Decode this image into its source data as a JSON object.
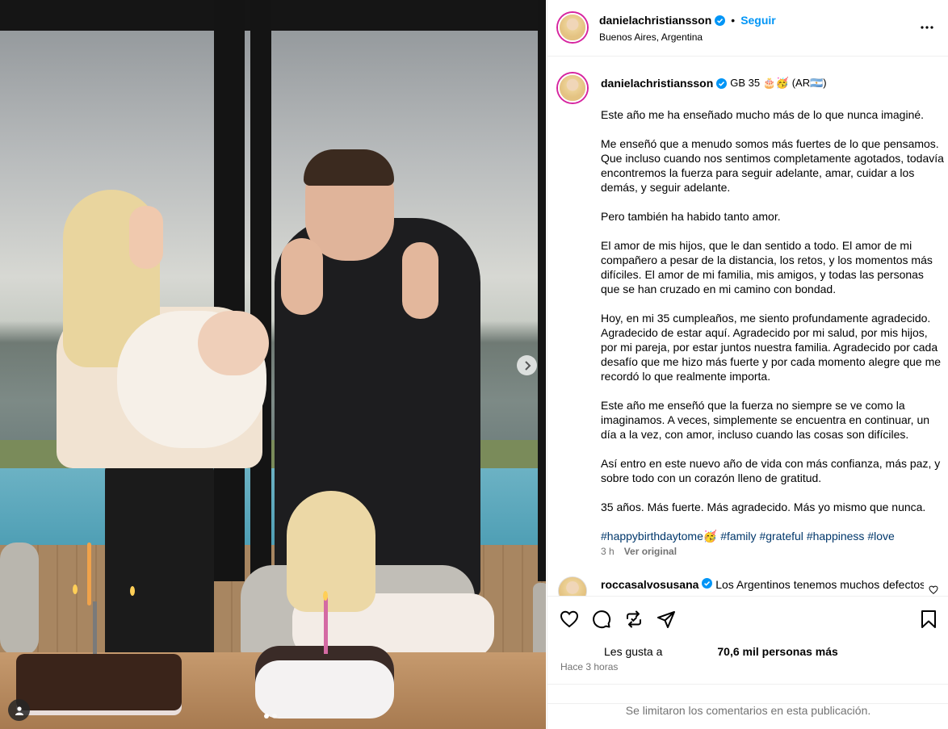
{
  "post": {
    "username": "danielachristiansson",
    "follow_label": "Seguir",
    "separator": "•",
    "location": "Buenos Aires, Argentina"
  },
  "caption": {
    "username": "danielachristiansson",
    "header_extra": "GB 35 🎂🥳 (AR🇦🇷)",
    "paragraphs": [
      "Este año me ha enseñado mucho más de lo que nunca imaginé.",
      "Me enseñó que a menudo somos más fuertes de lo que pensamos. Que incluso cuando nos sentimos completamente agotados, todavía encontremos la fuerza para seguir adelante, amar, cuidar a los demás, y seguir adelante.",
      "Pero también ha habido tanto amor.",
      "El amor de mis hijos, que le dan sentido a todo. El amor de mi compañero a pesar de la distancia, los retos, y los momentos más difíciles. El amor de mi familia, mis amigos, y todas las personas que se han cruzado en mi camino con bondad.",
      "Hoy, en mi 35 cumpleaños, me siento profundamente agradecido. Agradecido de estar aquí. Agradecido por mi salud, por mis hijos, por mi pareja, por estar juntos nuestra familia. Agradecido por cada desafío que me hizo más fuerte y por cada momento alegre que me recordó lo que realmente importa.",
      "Este año me enseñó que la fuerza no siempre se ve como la imaginamos. A veces, simplemente se encuentra en continuar, un día a la vez, con amor, incluso cuando las cosas son difíciles.",
      "Así entro en este nuevo año de vida con más confianza, más paz, y sobre todo con un corazón lleno de gratitud.",
      "35 años. Más fuerte. Más agradecido. Más yo mismo que nunca."
    ],
    "hashtags": [
      "#happybirthdaytome🥳",
      "#family",
      "#grateful",
      "#happiness",
      "#love"
    ],
    "time": "3 h",
    "see_original": "Ver original"
  },
  "comment": {
    "username": "roccasalvosusana",
    "text": "Los Argentinos tenemos muchos defectos,"
  },
  "actions": {
    "likes_label": "Les gusta a",
    "likes_count": "70,6 mil personas más",
    "posted_time": "Hace 3 horas",
    "comments_limited": "Se limitaron los comentarios en esta publicación."
  },
  "icons": {
    "verified": "verified-badge-icon",
    "more": "more-options-icon",
    "like": "heart-icon",
    "comment": "comment-icon",
    "repost": "repost-icon",
    "share": "share-icon",
    "save": "bookmark-icon",
    "next": "chevron-right-icon",
    "tag": "user-tag-icon"
  },
  "colors": {
    "accent": "#0095f6",
    "hashtag": "#00376b",
    "muted": "#737373",
    "border": "#efefef"
  }
}
